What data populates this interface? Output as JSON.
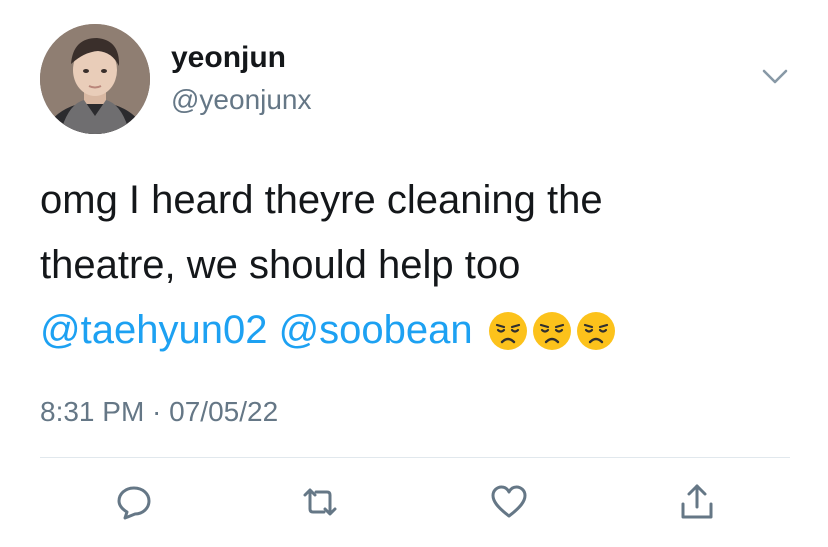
{
  "tweet": {
    "author": {
      "display_name": "yeonjun",
      "handle": "@yeonjunx",
      "avatar_icon": "avatar-photo"
    },
    "text_lines": [
      "omg I heard theyre cleaning the",
      "theatre, we should help too"
    ],
    "mentions": [
      "@taehyun02",
      "@soobean"
    ],
    "emojis": [
      "disappointed-face",
      "disappointed-face",
      "disappointed-face"
    ],
    "timestamp": "8:31 PM · 07/05/22"
  },
  "actions": [
    {
      "name": "reply",
      "icon": "speech-bubble-icon"
    },
    {
      "name": "retweet",
      "icon": "retweet-icon"
    },
    {
      "name": "like",
      "icon": "heart-icon"
    },
    {
      "name": "share",
      "icon": "share-icon"
    }
  ],
  "colors": {
    "text": "#14171a",
    "secondary": "#657786",
    "mention": "#1da1f2",
    "divider": "#e1e8ed",
    "emoji_face": "#fcc21b"
  }
}
